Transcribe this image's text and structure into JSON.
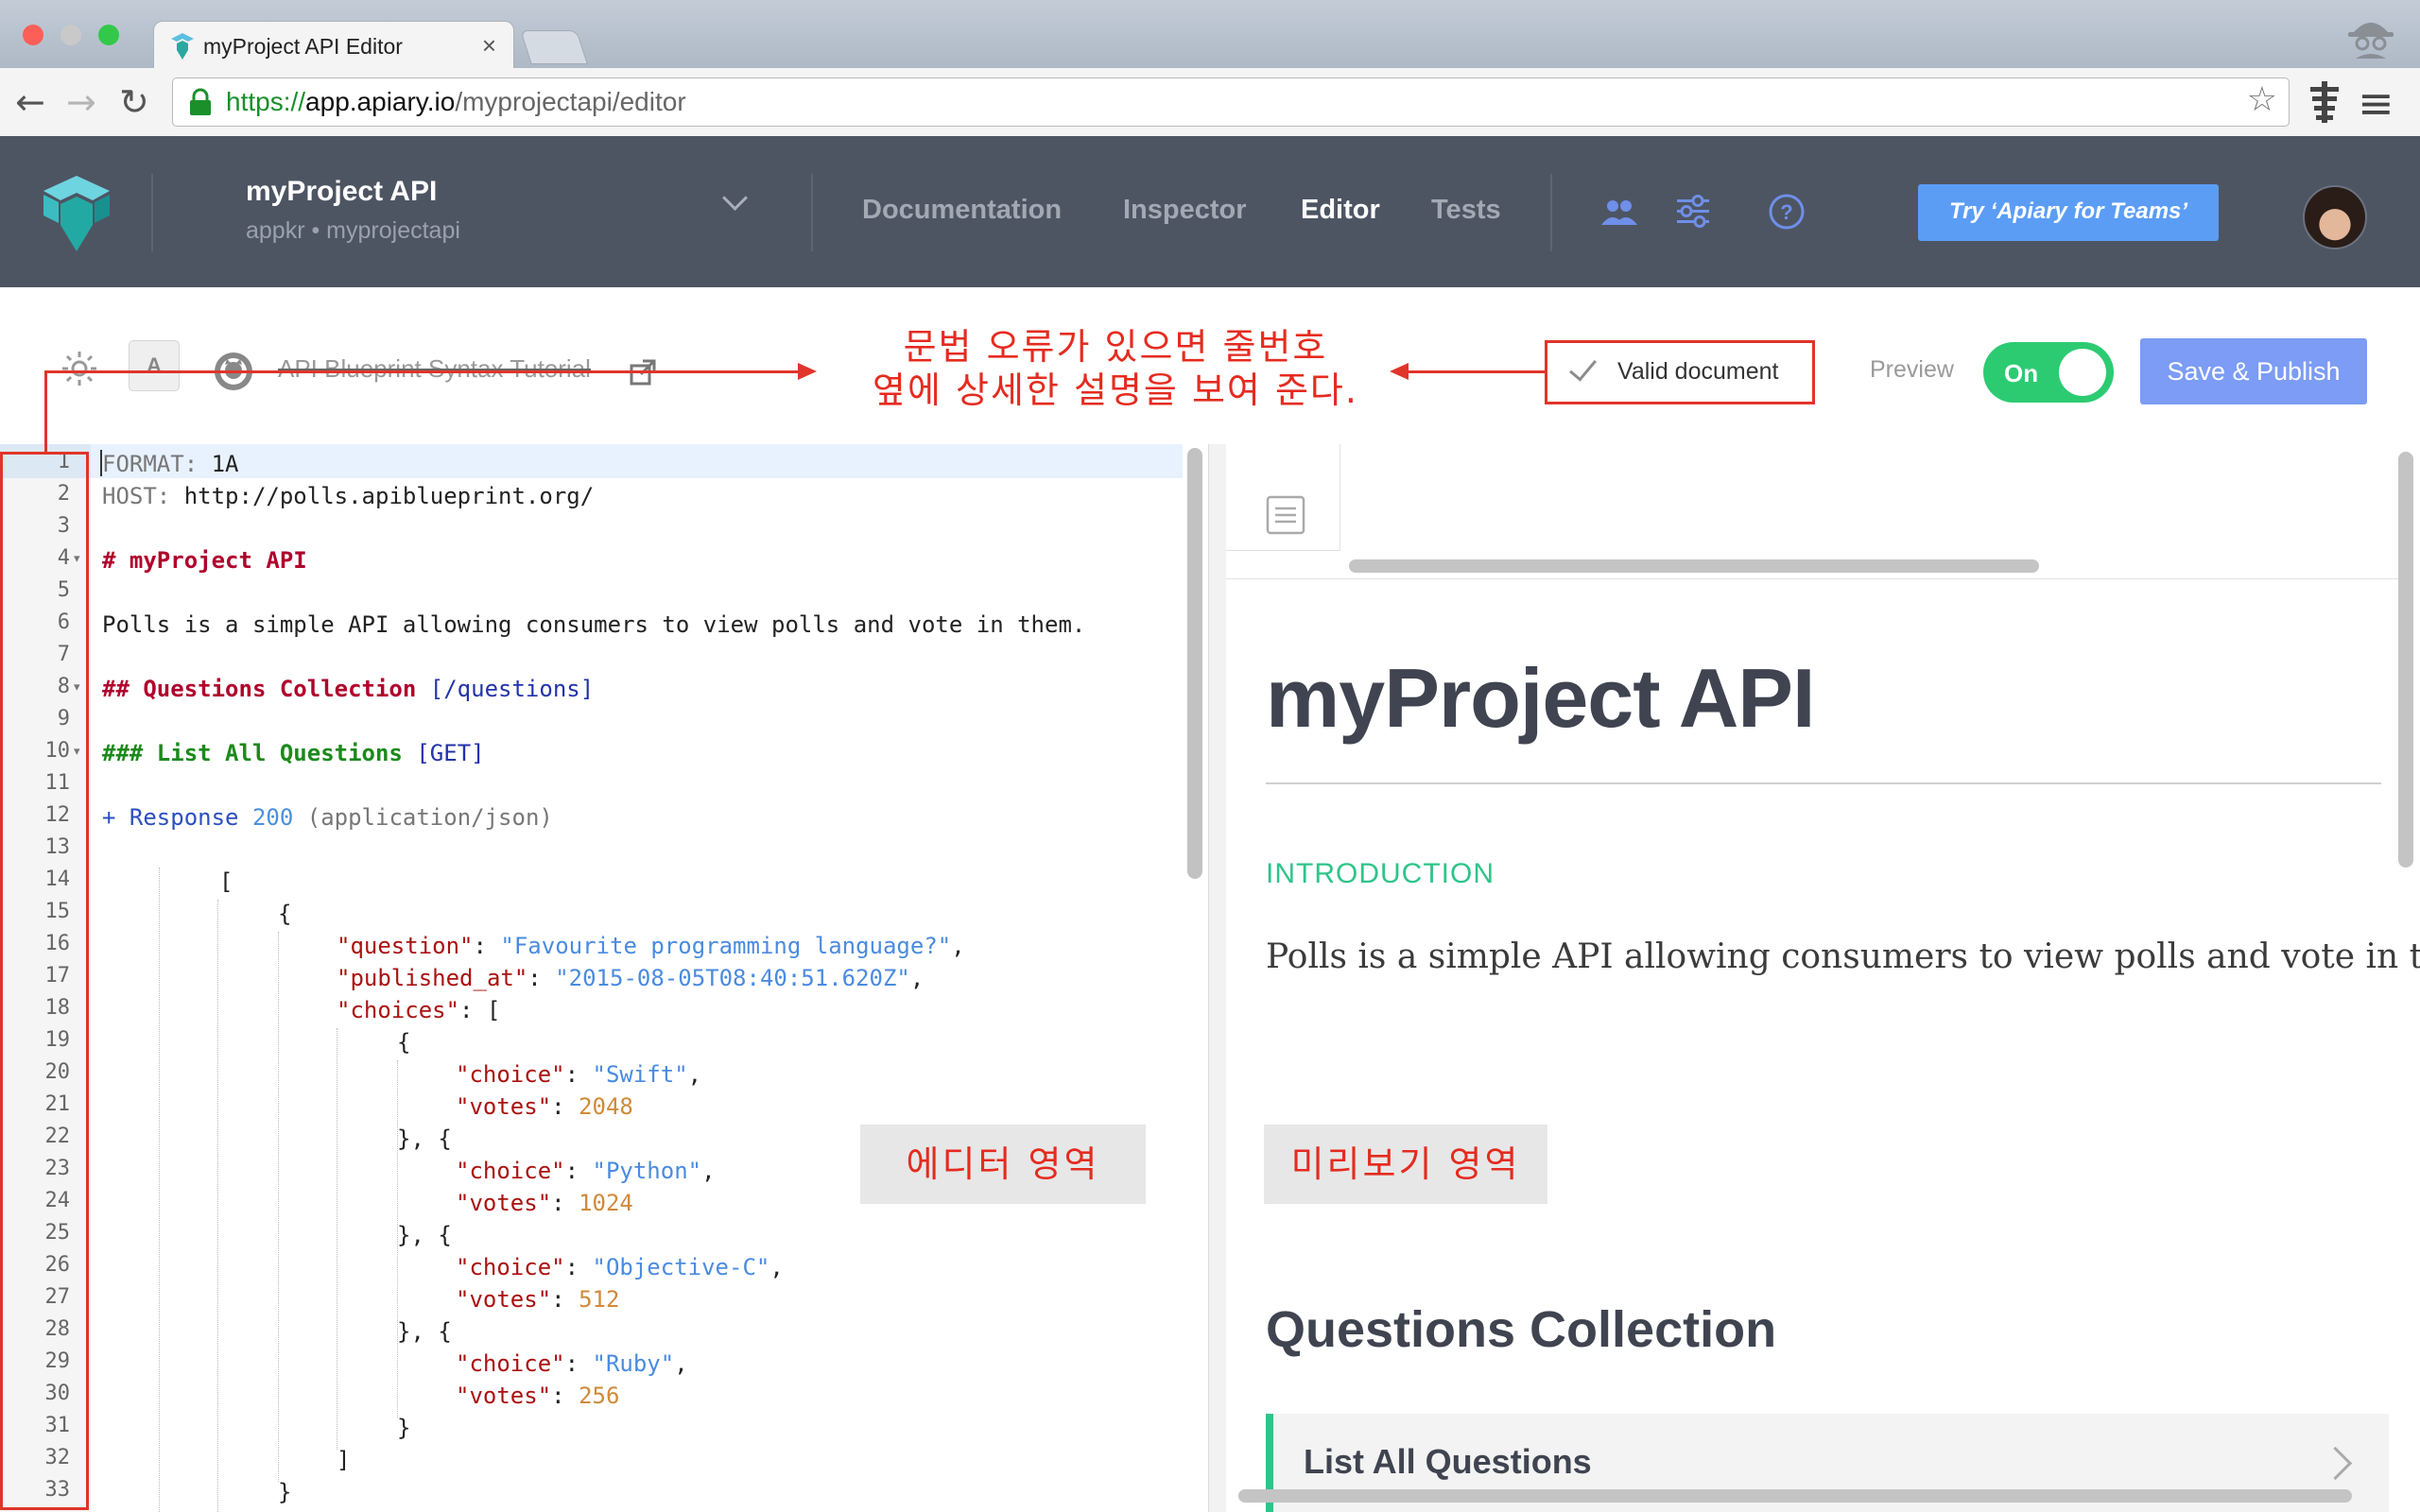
{
  "browser": {
    "tab_title": "myProject API Editor",
    "tab_close": "×",
    "url_scheme": "https://",
    "url_host": "app.apiary.io",
    "url_path": "/myprojectapi/editor",
    "back_glyph": "←",
    "forward_glyph": "→",
    "reload_glyph": "↻",
    "star_glyph": "☆",
    "menu_glyph": "≡"
  },
  "header": {
    "project_name": "myProject API",
    "project_sub": "appkr • myprojectapi",
    "nav": [
      "Documentation",
      "Inspector",
      "Editor",
      "Tests"
    ],
    "active_nav": "Editor",
    "try_button": "Try ‘Apiary for Teams’"
  },
  "toolbar": {
    "font_button": "A",
    "tutorial_link": "API Blueprint Syntax Tutorial",
    "valid_document": "Valid document",
    "preview_label": "Preview",
    "toggle_label": "On",
    "save_button": "Save & Publish"
  },
  "annotations": {
    "top_line1": "문법 오류가 있으면 줄번호",
    "top_line2": "옆에 상세한 설명을 보여 준다.",
    "editor_area": "에디터 영역",
    "preview_area": "미리보기 영역"
  },
  "editor": {
    "line_numbers": [
      "1",
      "2",
      "3",
      "4",
      "5",
      "6",
      "7",
      "8",
      "9",
      "10",
      "11",
      "12",
      "13",
      "14",
      "15",
      "16",
      "17",
      "18",
      "19",
      "20",
      "21",
      "22",
      "23",
      "24",
      "25",
      "26",
      "27",
      "28",
      "29",
      "30",
      "31",
      "32",
      "33"
    ],
    "fold_lines": [
      4,
      8,
      10
    ],
    "lines": {
      "l1_a": "FORMAT:",
      "l1_b": " 1A",
      "l2_a": "HOST:",
      "l2_b": " http://polls.apiblueprint.org/",
      "l4": "# myProject API",
      "l6": "Polls is a simple API allowing consumers to view polls and vote in them.",
      "l8_a": "## Questions Collection ",
      "l8_b": "[/questions]",
      "l10_a": "### List All Questions ",
      "l10_b": "[GET]",
      "l12_a": "+ Response ",
      "l12_b": "200",
      "l12_c": " (application/json)",
      "l14": "[",
      "l15": "{",
      "l16_k": "\"question\"",
      "l16_v": "\"Favourite programming language?\"",
      "l17_k": "\"published_at\"",
      "l17_v": "\"2015-08-05T08:40:51.620Z\"",
      "l18_k": "\"choices\"",
      "l18_v": "[",
      "l19": "{",
      "l20_k": "\"choice\"",
      "l20_v": "\"Swift\"",
      "l21_k": "\"votes\"",
      "l21_v": "2048",
      "l22": "}, {",
      "l23_k": "\"choice\"",
      "l23_v": "\"Python\"",
      "l24_k": "\"votes\"",
      "l24_v": "1024",
      "l25": "}, {",
      "l26_k": "\"choice\"",
      "l26_v": "\"Objective-C\"",
      "l27_k": "\"votes\"",
      "l27_v": "512",
      "l28": "}, {",
      "l29_k": "\"choice\"",
      "l29_v": "\"Ruby\"",
      "l30_k": "\"votes\"",
      "l30_v": "256",
      "l31": "}",
      "l32": "]",
      "l33": "}"
    }
  },
  "preview": {
    "title": "myProject API",
    "section_label": "INTRODUCTION",
    "description": "Polls is a simple API allowing consumers to view polls and vote in them.",
    "collection_title": "Questions Collection",
    "action_title": "List All Questions"
  },
  "colors": {
    "header_bg": "#4d5563",
    "accent_green": "#2ccb72",
    "save_blue": "#7c9cf5",
    "annotation_red": "#e0352a"
  },
  "icons": [
    "apiary-logo-icon",
    "lock-icon",
    "star-icon",
    "spy-icon",
    "extension-icon",
    "menu-icon",
    "team-icon",
    "settings-icon",
    "help-icon",
    "sun-icon",
    "github-icon",
    "external-link-icon",
    "check-icon",
    "document-icon"
  ]
}
